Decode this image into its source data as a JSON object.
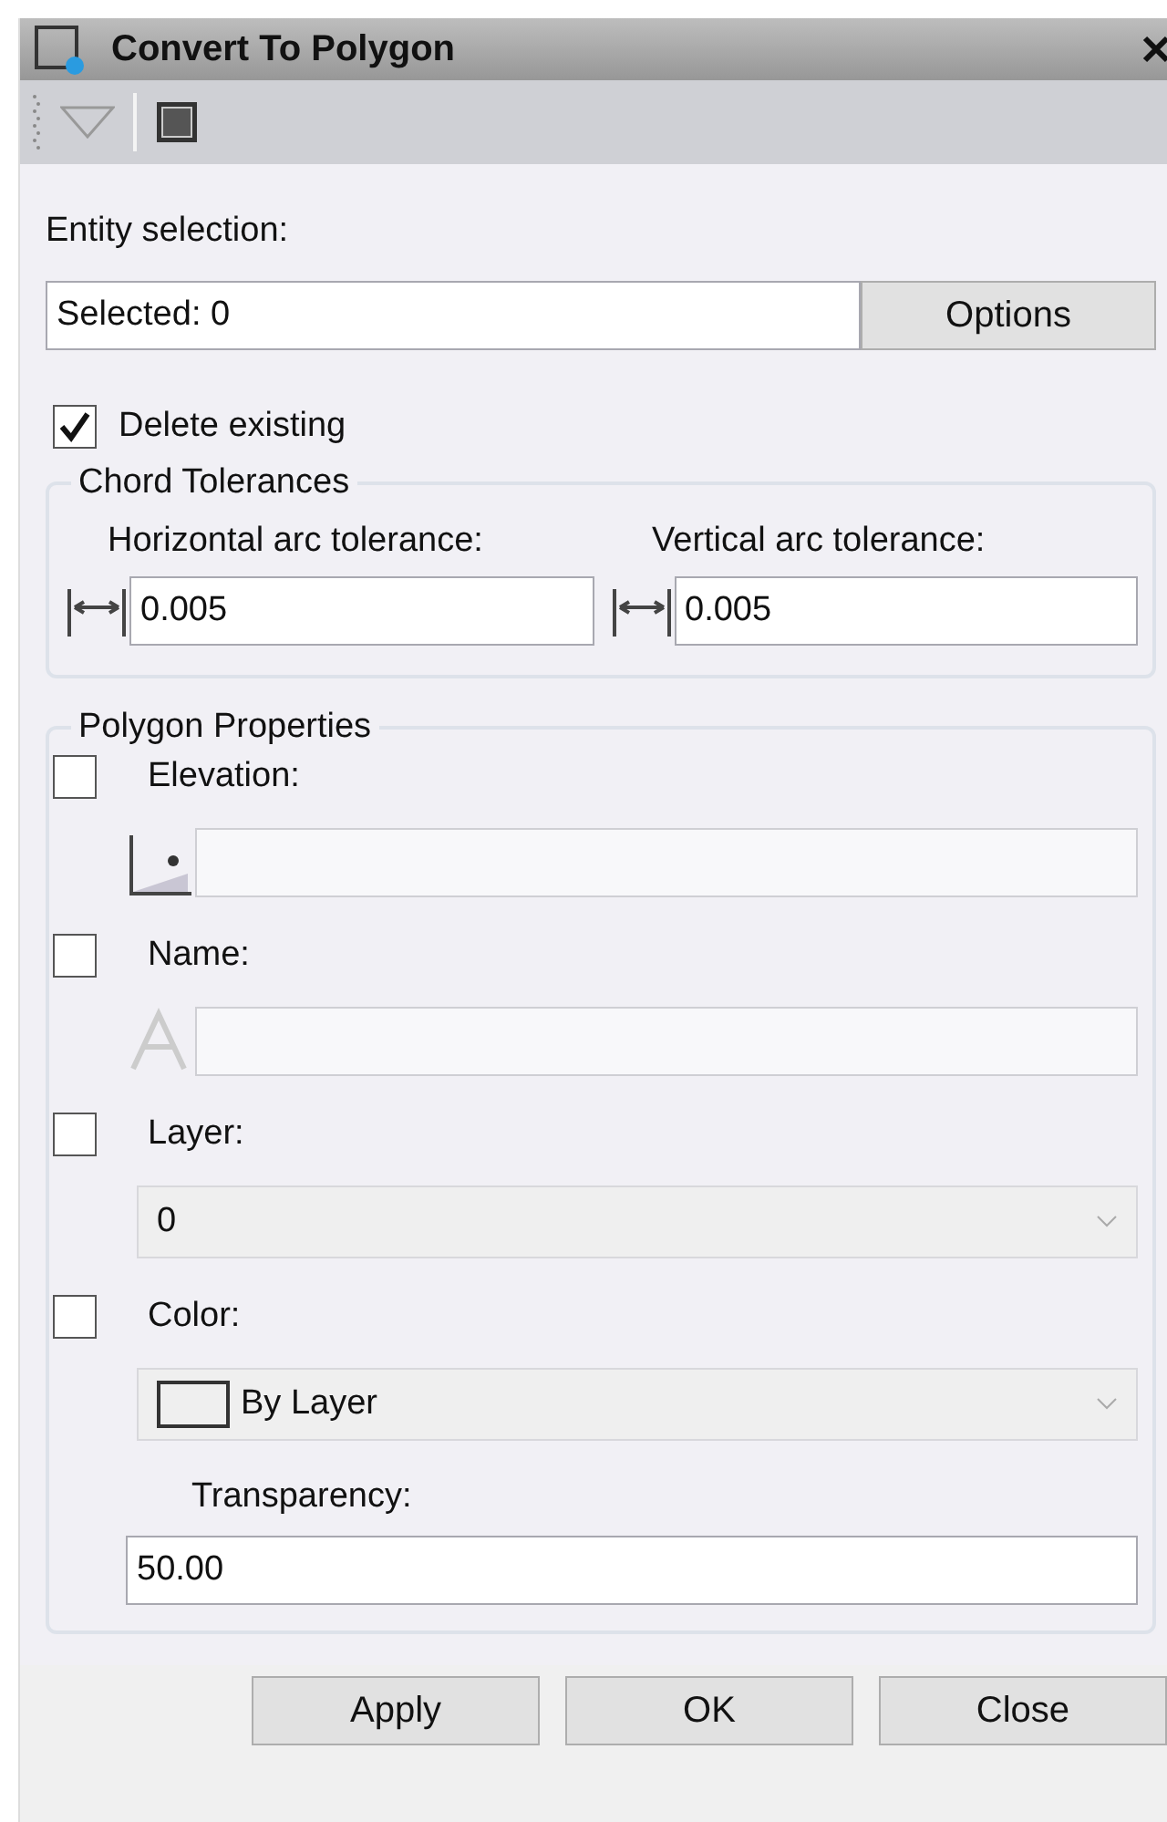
{
  "window": {
    "title": "Convert To Polygon"
  },
  "entity_selection": {
    "label": "Entity selection:",
    "value": "Selected: 0",
    "options_button": "Options"
  },
  "delete_existing": {
    "label": "Delete existing",
    "checked": true
  },
  "chord_tolerances": {
    "title": "Chord Tolerances",
    "fields": [
      {
        "label": "Horizontal arc tolerance:",
        "value": "0.005"
      },
      {
        "label": "Vertical arc tolerance:",
        "value": "0.005"
      }
    ]
  },
  "polygon_properties": {
    "title": "Polygon Properties",
    "items": [
      {
        "kind": "field",
        "label": "Elevation:",
        "checked": false
      },
      {
        "kind": "field",
        "label": "Name:",
        "checked": false
      },
      {
        "kind": "dropdown",
        "label": "Layer:",
        "checked": false,
        "value": "0"
      },
      {
        "kind": "colorpicker",
        "label": "Color:",
        "checked": false,
        "value": "By Layer"
      }
    ],
    "transparency": {
      "label": "Transparency:",
      "value": "50.00"
    }
  },
  "buttons": [
    "Apply",
    "OK",
    "Close"
  ]
}
